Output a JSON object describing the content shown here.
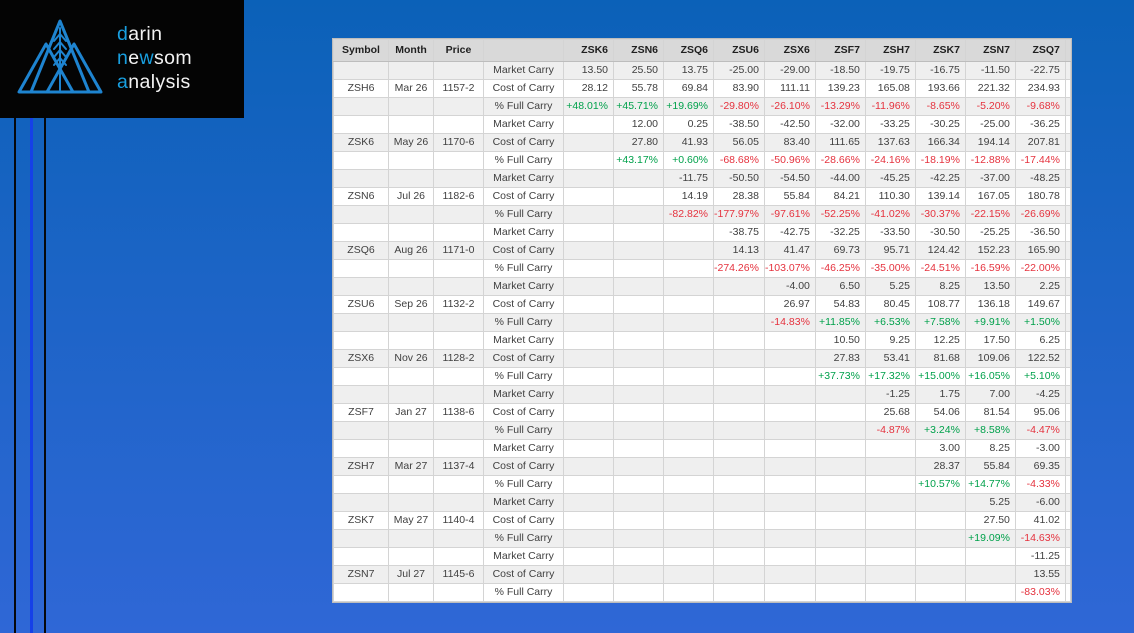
{
  "colors": {
    "bg_top": "#0b61b8",
    "bg_bottom": "#2f67d6",
    "logo_box": "#040404",
    "logo_mark_blue": "#1e84d0",
    "logo_accent_blue": "#189fe0",
    "logo_text_white": "#f3f3f3",
    "decor_line_black": "#06080c",
    "decor_line_blue": "#1540e8",
    "header_bg": "#d9d9d9",
    "row_stripe": "#efefef",
    "row_plain": "#ffffff",
    "grid_line": "#d4d4d4",
    "number_text": "#404040",
    "positive_pct": "#00a14b",
    "negative_pct": "#e5323e"
  },
  "logo": {
    "mark_icon": "mountains-wheat-logo-icon",
    "lines": [
      {
        "segments": [
          {
            "t": "d",
            "accent": true
          },
          {
            "t": "arin",
            "accent": false
          }
        ]
      },
      {
        "segments": [
          {
            "t": "n",
            "accent": true
          },
          {
            "t": "e",
            "accent": false
          },
          {
            "t": "w",
            "accent": true
          },
          {
            "t": "som",
            "accent": false
          }
        ]
      },
      {
        "segments": [
          {
            "t": "a",
            "accent": true
          },
          {
            "t": "nalysis",
            "accent": false
          }
        ]
      }
    ]
  },
  "chart_data": {
    "type": "table",
    "title": "Soybean futures carry table (Darin Newsom Analysis)",
    "columns": [
      "Symbol",
      "Month",
      "Price",
      "",
      "ZSK6",
      "ZSN6",
      "ZSQ6",
      "ZSU6",
      "ZSX6",
      "ZSF7",
      "ZSH7",
      "ZSK7",
      "ZSN7",
      "ZSQ7"
    ],
    "row_labels": {
      "market": "Market Carry",
      "cost": "Cost of Carry",
      "pct": "% Full Carry"
    },
    "groups": [
      {
        "symbol": "ZSH6",
        "month": "Mar 26",
        "price": "1157-2",
        "market": [
          "13.50",
          "25.50",
          "13.75",
          "-25.00",
          "-29.00",
          "-18.50",
          "-19.75",
          "-16.75",
          "-11.50",
          "-22.75"
        ],
        "cost": [
          "28.12",
          "55.78",
          "69.84",
          "83.90",
          "111.11",
          "139.23",
          "165.08",
          "193.66",
          "221.32",
          "234.93"
        ],
        "pct": [
          "+48.01%",
          "+45.71%",
          "+19.69%",
          "-29.80%",
          "-26.10%",
          "-13.29%",
          "-11.96%",
          "-8.65%",
          "-5.20%",
          "-9.68%"
        ]
      },
      {
        "symbol": "ZSK6",
        "month": "May 26",
        "price": "1170-6",
        "market": [
          "",
          "12.00",
          "0.25",
          "-38.50",
          "-42.50",
          "-32.00",
          "-33.25",
          "-30.25",
          "-25.00",
          "-36.25"
        ],
        "cost": [
          "",
          "27.80",
          "41.93",
          "56.05",
          "83.40",
          "111.65",
          "137.63",
          "166.34",
          "194.14",
          "207.81"
        ],
        "pct": [
          "",
          "+43.17%",
          "+0.60%",
          "-68.68%",
          "-50.96%",
          "-28.66%",
          "-24.16%",
          "-18.19%",
          "-12.88%",
          "-17.44%"
        ]
      },
      {
        "symbol": "ZSN6",
        "month": "Jul 26",
        "price": "1182-6",
        "market": [
          "",
          "",
          "-11.75",
          "-50.50",
          "-54.50",
          "-44.00",
          "-45.25",
          "-42.25",
          "-37.00",
          "-48.25"
        ],
        "cost": [
          "",
          "",
          "14.19",
          "28.38",
          "55.84",
          "84.21",
          "110.30",
          "139.14",
          "167.05",
          "180.78"
        ],
        "pct": [
          "",
          "",
          "-82.82%",
          "-177.97%",
          "-97.61%",
          "-52.25%",
          "-41.02%",
          "-30.37%",
          "-22.15%",
          "-26.69%"
        ]
      },
      {
        "symbol": "ZSQ6",
        "month": "Aug 26",
        "price": "1171-0",
        "market": [
          "",
          "",
          "",
          "-38.75",
          "-42.75",
          "-32.25",
          "-33.50",
          "-30.50",
          "-25.25",
          "-36.50"
        ],
        "cost": [
          "",
          "",
          "",
          "14.13",
          "41.47",
          "69.73",
          "95.71",
          "124.42",
          "152.23",
          "165.90"
        ],
        "pct": [
          "",
          "",
          "",
          "-274.26%",
          "-103.07%",
          "-46.25%",
          "-35.00%",
          "-24.51%",
          "-16.59%",
          "-22.00%"
        ]
      },
      {
        "symbol": "ZSU6",
        "month": "Sep 26",
        "price": "1132-2",
        "market": [
          "",
          "",
          "",
          "",
          "-4.00",
          "6.50",
          "5.25",
          "8.25",
          "13.50",
          "2.25"
        ],
        "cost": [
          "",
          "",
          "",
          "",
          "26.97",
          "54.83",
          "80.45",
          "108.77",
          "136.18",
          "149.67"
        ],
        "pct": [
          "",
          "",
          "",
          "",
          "-14.83%",
          "+11.85%",
          "+6.53%",
          "+7.58%",
          "+9.91%",
          "+1.50%"
        ]
      },
      {
        "symbol": "ZSX6",
        "month": "Nov 26",
        "price": "1128-2",
        "market": [
          "",
          "",
          "",
          "",
          "",
          "10.50",
          "9.25",
          "12.25",
          "17.50",
          "6.25"
        ],
        "cost": [
          "",
          "",
          "",
          "",
          "",
          "27.83",
          "53.41",
          "81.68",
          "109.06",
          "122.52"
        ],
        "pct": [
          "",
          "",
          "",
          "",
          "",
          "+37.73%",
          "+17.32%",
          "+15.00%",
          "+16.05%",
          "+5.10%"
        ]
      },
      {
        "symbol": "ZSF7",
        "month": "Jan 27",
        "price": "1138-6",
        "market": [
          "",
          "",
          "",
          "",
          "",
          "",
          "-1.25",
          "1.75",
          "7.00",
          "-4.25"
        ],
        "cost": [
          "",
          "",
          "",
          "",
          "",
          "",
          "25.68",
          "54.06",
          "81.54",
          "95.06"
        ],
        "pct": [
          "",
          "",
          "",
          "",
          "",
          "",
          "-4.87%",
          "+3.24%",
          "+8.58%",
          "-4.47%"
        ]
      },
      {
        "symbol": "ZSH7",
        "month": "Mar 27",
        "price": "1137-4",
        "market": [
          "",
          "",
          "",
          "",
          "",
          "",
          "",
          "3.00",
          "8.25",
          "-3.00"
        ],
        "cost": [
          "",
          "",
          "",
          "",
          "",
          "",
          "",
          "28.37",
          "55.84",
          "69.35"
        ],
        "pct": [
          "",
          "",
          "",
          "",
          "",
          "",
          "",
          "+10.57%",
          "+14.77%",
          "-4.33%"
        ]
      },
      {
        "symbol": "ZSK7",
        "month": "May 27",
        "price": "1140-4",
        "market": [
          "",
          "",
          "",
          "",
          "",
          "",
          "",
          "",
          "5.25",
          "-6.00"
        ],
        "cost": [
          "",
          "",
          "",
          "",
          "",
          "",
          "",
          "",
          "27.50",
          "41.02"
        ],
        "pct": [
          "",
          "",
          "",
          "",
          "",
          "",
          "",
          "",
          "+19.09%",
          "-14.63%"
        ]
      },
      {
        "symbol": "ZSN7",
        "month": "Jul 27",
        "price": "1145-6",
        "market": [
          "",
          "",
          "",
          "",
          "",
          "",
          "",
          "",
          "",
          "-11.25"
        ],
        "cost": [
          "",
          "",
          "",
          "",
          "",
          "",
          "",
          "",
          "",
          "13.55"
        ],
        "pct": [
          "",
          "",
          "",
          "",
          "",
          "",
          "",
          "",
          "",
          "-83.03%"
        ]
      }
    ]
  }
}
